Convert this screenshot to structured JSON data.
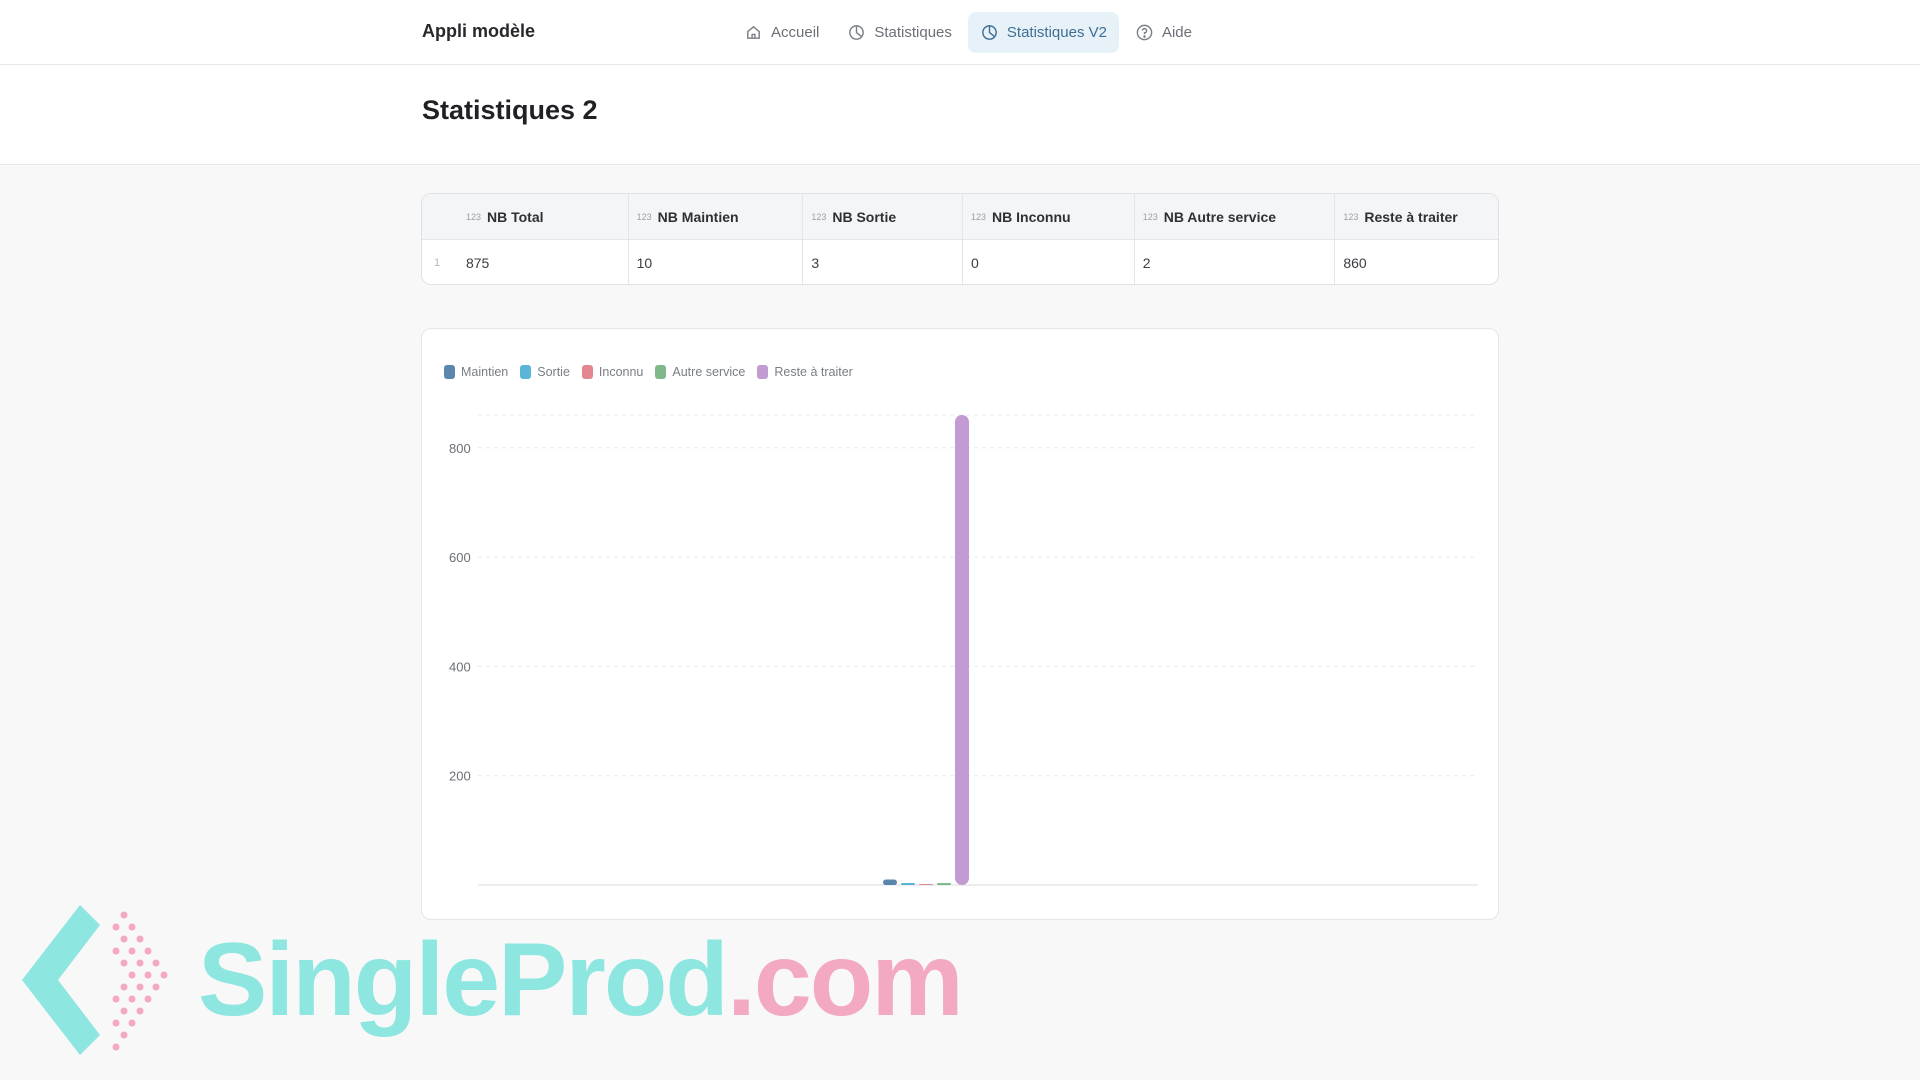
{
  "header": {
    "app_title": "Appli modèle",
    "nav": [
      {
        "label": "Accueil",
        "icon": "home-icon",
        "active": false
      },
      {
        "label": "Statistiques",
        "icon": "pie-chart-icon",
        "active": false
      },
      {
        "label": "Statistiques V2",
        "icon": "pie-chart-icon",
        "active": true
      },
      {
        "label": "Aide",
        "icon": "help-circle-icon",
        "active": false
      }
    ]
  },
  "page": {
    "title": "Statistiques 2"
  },
  "table": {
    "type_icon": "123",
    "columns": [
      "NB Total",
      "NB Maintien",
      "NB Sortie",
      "NB Inconnu",
      "NB Autre service",
      "Reste à traiter"
    ],
    "rows": [
      {
        "index": "1",
        "cells": [
          "875",
          "10",
          "3",
          "0",
          "2",
          "860"
        ]
      }
    ]
  },
  "chart_data": {
    "type": "bar",
    "title": "",
    "xlabel": "",
    "ylabel": "",
    "ylim": [
      0,
      860
    ],
    "yticks": [
      "800",
      "600",
      "400",
      "200"
    ],
    "grid": true,
    "legend_position": "top-left",
    "series": [
      {
        "name": "Maintien",
        "values": [
          10
        ],
        "color": "#5b85ad"
      },
      {
        "name": "Sortie",
        "values": [
          3
        ],
        "color": "#5bb5d6"
      },
      {
        "name": "Inconnu",
        "values": [
          0
        ],
        "color": "#e3868f"
      },
      {
        "name": "Autre service",
        "values": [
          2
        ],
        "color": "#7fb98a"
      },
      {
        "name": "Reste à traiter",
        "values": [
          860
        ],
        "color": "#c39bd3"
      }
    ]
  },
  "watermark": {
    "text_main": "SingleProd",
    "text_suffix": ".com"
  },
  "colors": {
    "accent": "#3f6f94",
    "active_bg": "#e6f1f8"
  }
}
